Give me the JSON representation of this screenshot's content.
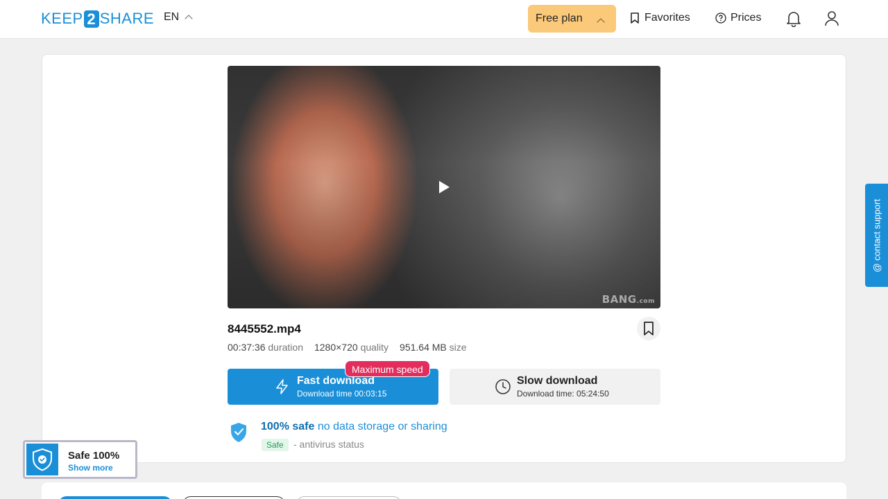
{
  "header": {
    "logo_left": "KEEP",
    "logo_mid": "2",
    "logo_right": "SHARE",
    "language": "EN",
    "free_plan": "Free plan",
    "favorites": "Favorites",
    "prices": "Prices"
  },
  "file": {
    "name": "8445552.mp4",
    "duration_value": "00:37:36",
    "duration_label": "duration",
    "quality_value": "1280×720",
    "quality_label": "quality",
    "size_value": "951.64 MB",
    "size_label": "size",
    "watermark": "BANG",
    "watermark_suffix": ".com"
  },
  "download": {
    "badge": "Maximum speed",
    "fast_label": "Fast download",
    "fast_time": "Download time 00:03:15",
    "slow_label": "Slow download",
    "slow_time": "Download time: 05:24:50"
  },
  "safety": {
    "safe_bold": "100% safe",
    "safe_rest": "no data storage or sharing",
    "badge": "Safe",
    "status": "- antivirus status"
  },
  "support": {
    "label": "@ contact support"
  },
  "popup": {
    "title": "Safe 100%",
    "link": "Show more"
  },
  "colors": {
    "accent": "#1a8fd8",
    "plan": "#fbc97a",
    "badge": "#e22d5d"
  }
}
